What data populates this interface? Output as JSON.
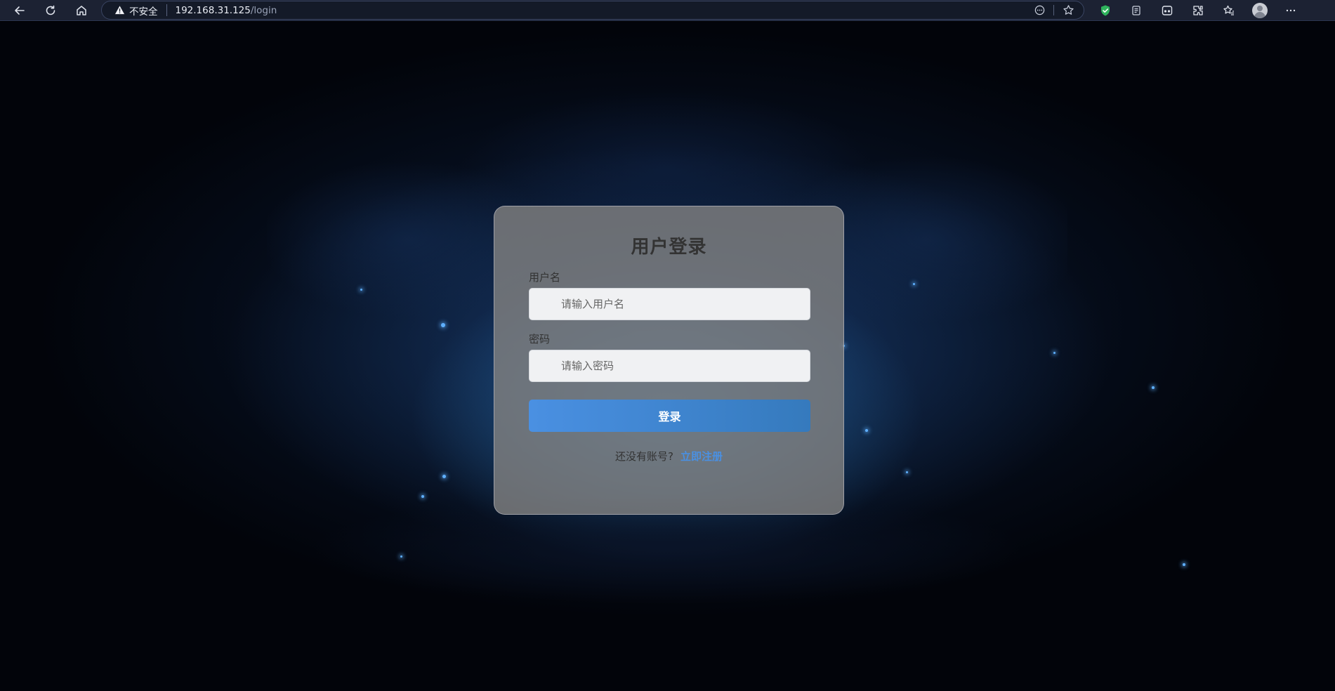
{
  "browser": {
    "security_label": "不安全",
    "url_host": "192.168.31.125",
    "url_path": "/login",
    "icons": [
      "back-icon",
      "reload-icon",
      "home-icon",
      "warning-icon",
      "reader-icon",
      "favorite-star-icon",
      "shield-extension-icon",
      "collections-icon",
      "game-icon",
      "extensions-icon",
      "favorites-icon",
      "profile-avatar",
      "more-icon"
    ]
  },
  "login": {
    "title": "用户登录",
    "username_label": "用户名",
    "username_placeholder": "请输入用户名",
    "password_label": "密码",
    "password_placeholder": "请输入密码",
    "submit_label": "登录",
    "register_prompt": "还没有账号?",
    "register_link": "立即注册"
  },
  "colors": {
    "accent": "#4a90e2",
    "card_bg": "#808080",
    "toolbar_bg": "#1c2233"
  }
}
